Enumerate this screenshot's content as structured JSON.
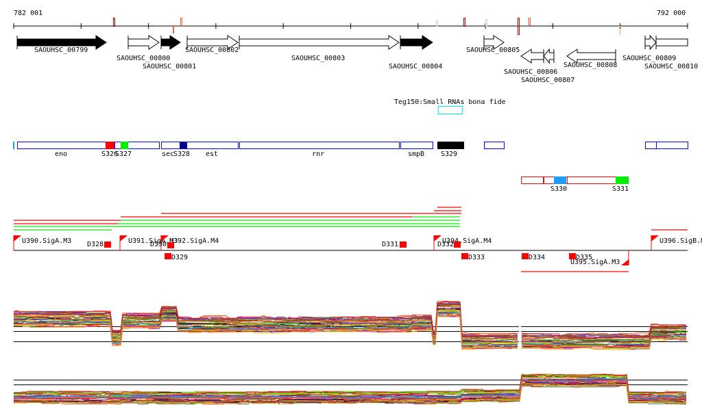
{
  "ruler": {
    "start_label": "782 001",
    "end_label": "792 000"
  },
  "genes": [
    {
      "label": "SAOUHSC_00799",
      "strand": "+",
      "filled": true
    },
    {
      "label": "SAOUHSC_00800",
      "strand": "+",
      "filled": false
    },
    {
      "label": "SAOUHSC_00801",
      "strand": "+",
      "filled": true
    },
    {
      "label": "SAOUHSC_00802",
      "strand": "+",
      "filled": false
    },
    {
      "label": "SAOUHSC_00803",
      "strand": "+",
      "filled": false
    },
    {
      "label": "SAOUHSC_00804",
      "strand": "+",
      "filled": true
    },
    {
      "label": "SAOUHSC_00805",
      "strand": "+",
      "filled": false
    },
    {
      "label": "SAOUHSC_00806",
      "strand": "-",
      "filled": false
    },
    {
      "label": "SAOUHSC_00807",
      "strand": "-",
      "filled": false
    },
    {
      "label": "SAOUHSC_00808",
      "strand": "-",
      "filled": false
    },
    {
      "label": "SAOUHSC_00809",
      "strand": "+",
      "filled": false
    },
    {
      "label": "SAOUHSC_00810",
      "strand": "+",
      "filled": false
    }
  ],
  "small_rna": {
    "label": "Teg150:Small RNAs bona fide",
    "color": "#00e5ee"
  },
  "operon_labels": [
    "eno",
    "S326",
    "S327",
    "sec",
    "S328",
    "est",
    "rnr",
    "smpB",
    "S329"
  ],
  "segment_labels": [
    "S330",
    "S331"
  ],
  "promoters": [
    "U390.SigA.M3",
    "U391.SigA.M3",
    "U392.SigA.M4",
    "U394.SigA.M4",
    "U395.SigA.M3",
    "U396.SigB.M"
  ],
  "terminators": [
    "D328",
    "D329",
    "D330",
    "D331",
    "D332",
    "D333",
    "D334",
    "D335"
  ],
  "colors": {
    "operon": "#0000ff",
    "promoter": "#ff0000",
    "green": "#00ee00",
    "navy": "#000090",
    "sky": "#1e9bff"
  }
}
